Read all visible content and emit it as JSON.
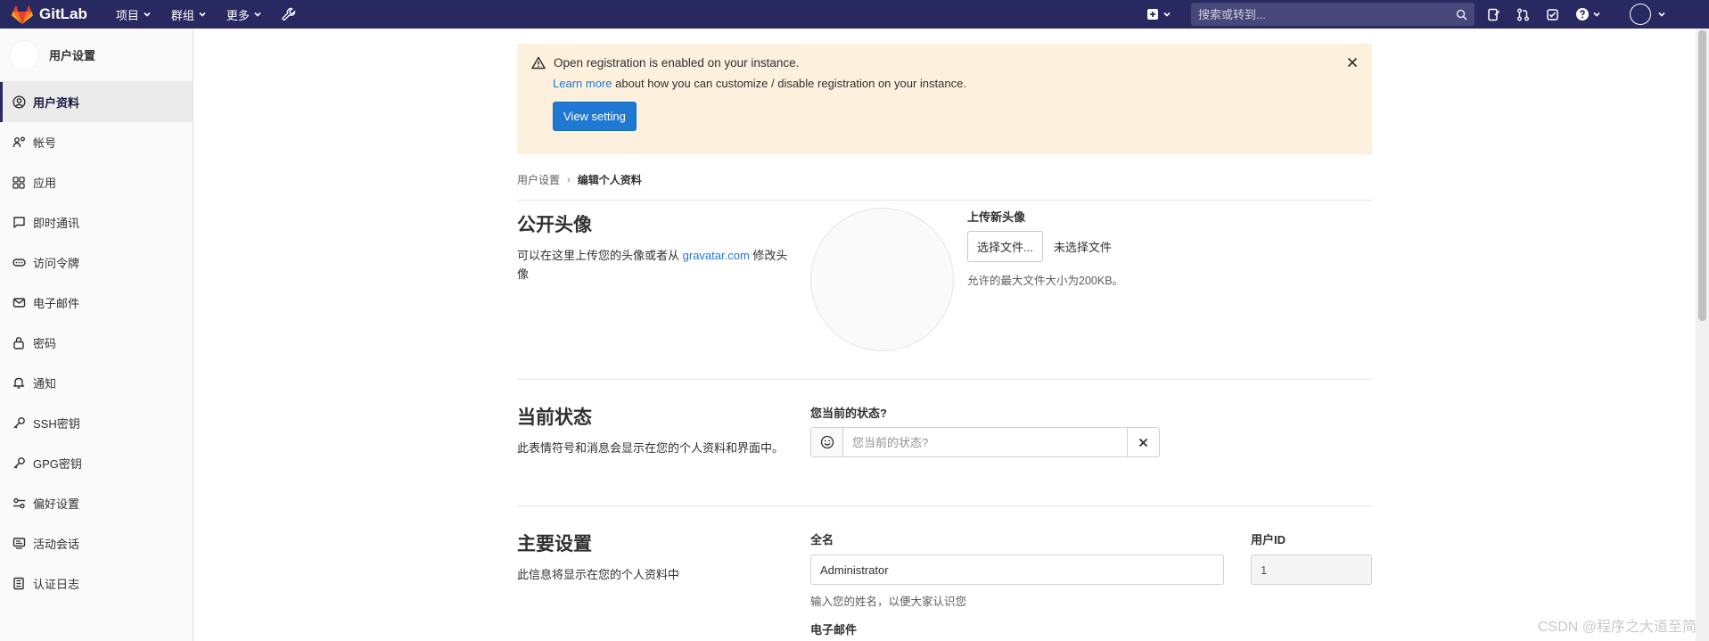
{
  "navbar": {
    "brand": "GitLab",
    "menu": [
      {
        "label": "项目"
      },
      {
        "label": "群组"
      },
      {
        "label": "更多"
      }
    ],
    "search_placeholder": "搜索或转到..."
  },
  "sidebar": {
    "title": "用户设置",
    "items": [
      {
        "label": "用户资料",
        "icon": "profile-icon"
      },
      {
        "label": "帐号",
        "icon": "account-icon"
      },
      {
        "label": "应用",
        "icon": "applications-icon"
      },
      {
        "label": "即时通讯",
        "icon": "chat-icon"
      },
      {
        "label": "访问令牌",
        "icon": "token-icon"
      },
      {
        "label": "电子邮件",
        "icon": "email-icon"
      },
      {
        "label": "密码",
        "icon": "lock-icon"
      },
      {
        "label": "通知",
        "icon": "bell-icon"
      },
      {
        "label": "SSH密钥",
        "icon": "key-icon"
      },
      {
        "label": "GPG密钥",
        "icon": "key-icon"
      },
      {
        "label": "偏好设置",
        "icon": "preferences-icon"
      },
      {
        "label": "活动会话",
        "icon": "monitor-icon"
      },
      {
        "label": "认证日志",
        "icon": "log-icon"
      }
    ]
  },
  "alert": {
    "title": "Open registration is enabled on your instance.",
    "link": "Learn more",
    "body": "about how you can customize / disable registration on your instance.",
    "button": "View setting"
  },
  "breadcrumb": {
    "parent": "用户设置",
    "current": "编辑个人资料"
  },
  "avatar_section": {
    "title": "公开头像",
    "desc_before": "可以在这里上传您的头像或者从",
    "desc_link": "gravatar.com",
    "desc_after": "修改头像",
    "upload_label": "上传新头像",
    "file_button": "选择文件...",
    "file_status": "未选择文件",
    "hint": "允许的最大文件大小为200KB。"
  },
  "status_section": {
    "title": "当前状态",
    "desc": "此表情符号和消息会显示在您的个人资料和界面中。",
    "field_label": "您当前的状态?",
    "placeholder": "您当前的状态?"
  },
  "main_section": {
    "title": "主要设置",
    "desc": "此信息将显示在您的个人资料中",
    "fullname_label": "全名",
    "fullname_value": "Administrator",
    "fullname_hint": "输入您的姓名，以便大家认识您",
    "userid_label": "用户ID",
    "userid_value": "1",
    "email_label": "电子邮件"
  },
  "watermark": "CSDN @程序之大道至简",
  "colors": {
    "navbar": "#292961",
    "link": "#1f78d1",
    "alert_bg": "#fdf1dd"
  }
}
